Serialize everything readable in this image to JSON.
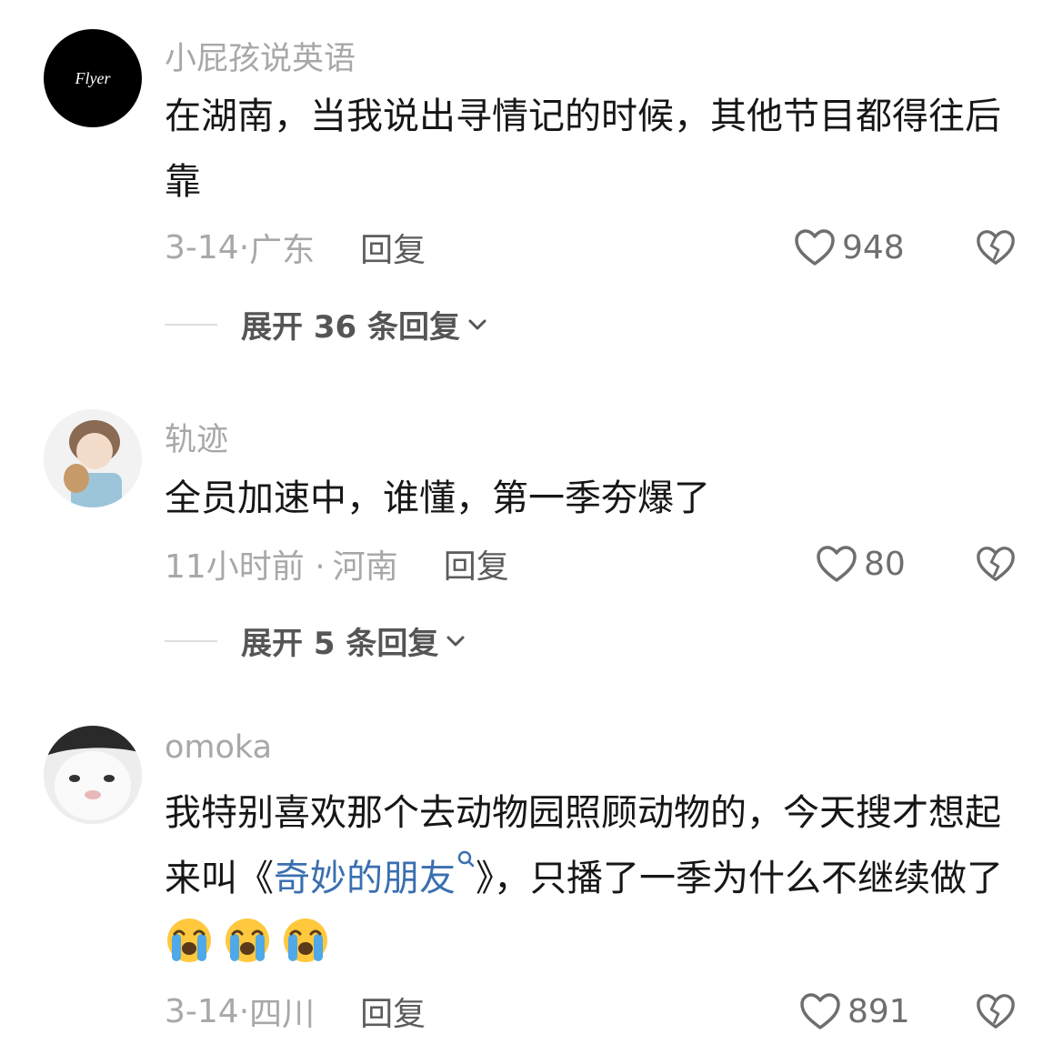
{
  "colors": {
    "link": "#3a6fb0",
    "muted": "#a8a8a8",
    "text": "#161616"
  },
  "comments": [
    {
      "username": "小屁孩说英语",
      "avatar_text": "Flyer",
      "text": "在湖南，当我说出寻情记的时候，其他节目都得往后靠",
      "date": "3-14·",
      "location": "广东",
      "reply_label": "回复",
      "likes": "948",
      "expand_label": "展开 36 条回复"
    },
    {
      "username": "轨迹",
      "text": "全员加速中，谁懂，第一季夯爆了",
      "date": "11小时前 ·",
      "location": "河南",
      "reply_label": "回复",
      "likes": "80",
      "expand_label": "展开 5 条回复"
    },
    {
      "username": "omoka",
      "text_before": "我特别喜欢那个去动物园照顾动物的，今天搜才想起来叫《",
      "link_text": "奇妙的朋友",
      "text_after": "》，只播了一季为什么不继续做了",
      "emojis": [
        "loudly-crying-face",
        "loudly-crying-face",
        "loudly-crying-face"
      ],
      "date": "3-14·",
      "location": "四川",
      "reply_label": "回复",
      "likes": "891"
    }
  ]
}
